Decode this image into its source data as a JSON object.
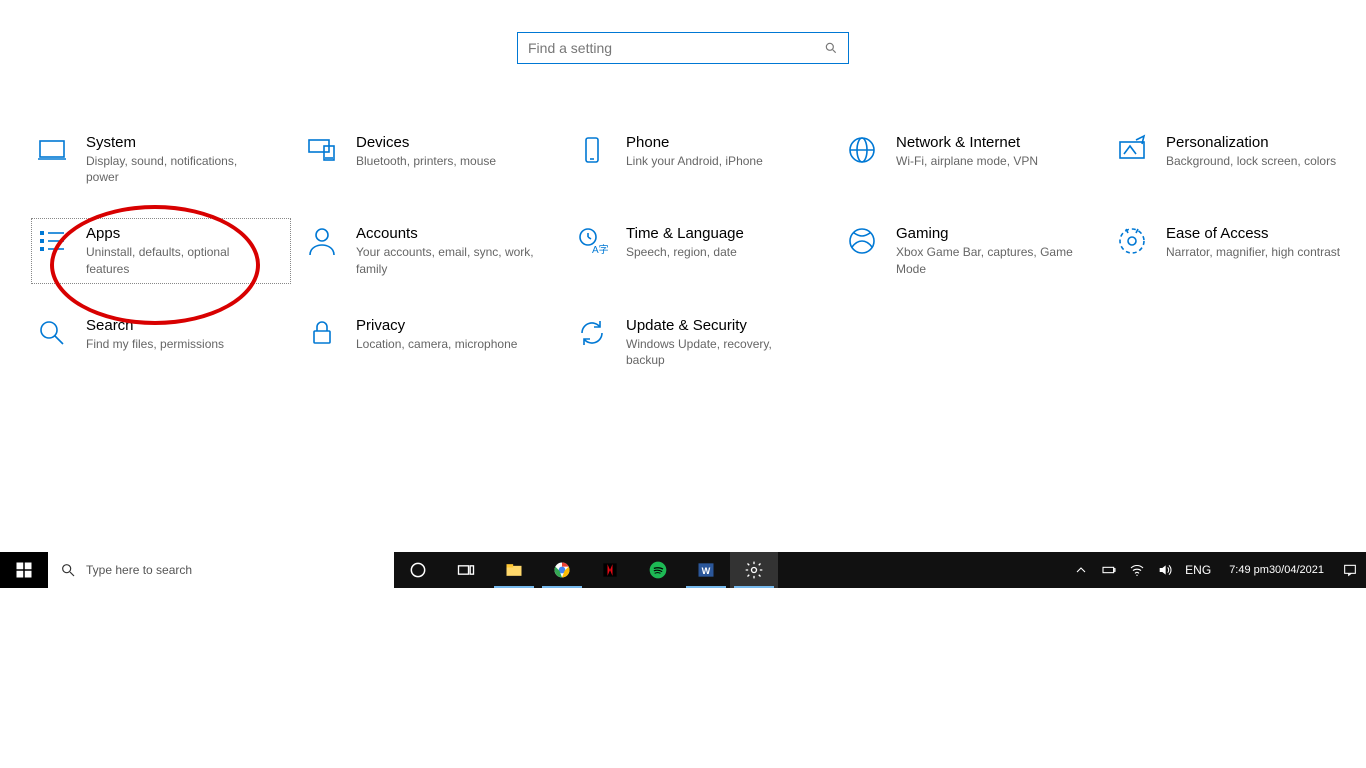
{
  "search": {
    "placeholder": "Find a setting"
  },
  "tiles": [
    {
      "title": "System",
      "desc": "Display, sound, notifications, power"
    },
    {
      "title": "Devices",
      "desc": "Bluetooth, printers, mouse"
    },
    {
      "title": "Phone",
      "desc": "Link your Android, iPhone"
    },
    {
      "title": "Network & Internet",
      "desc": "Wi-Fi, airplane mode, VPN"
    },
    {
      "title": "Personalization",
      "desc": "Background, lock screen, colors"
    },
    {
      "title": "Apps",
      "desc": "Uninstall, defaults, optional features"
    },
    {
      "title": "Accounts",
      "desc": "Your accounts, email, sync, work, family"
    },
    {
      "title": "Time & Language",
      "desc": "Speech, region, date"
    },
    {
      "title": "Gaming",
      "desc": "Xbox Game Bar, captures, Game Mode"
    },
    {
      "title": "Ease of Access",
      "desc": "Narrator, magnifier, high contrast"
    },
    {
      "title": "Search",
      "desc": "Find my files, permissions"
    },
    {
      "title": "Privacy",
      "desc": "Location, camera, microphone"
    },
    {
      "title": "Update & Security",
      "desc": "Windows Update, recovery, backup"
    }
  ],
  "taskbar": {
    "search_placeholder": "Type here to search",
    "language": "ENG",
    "time": "7:49 pm",
    "date": "30/04/2021"
  }
}
